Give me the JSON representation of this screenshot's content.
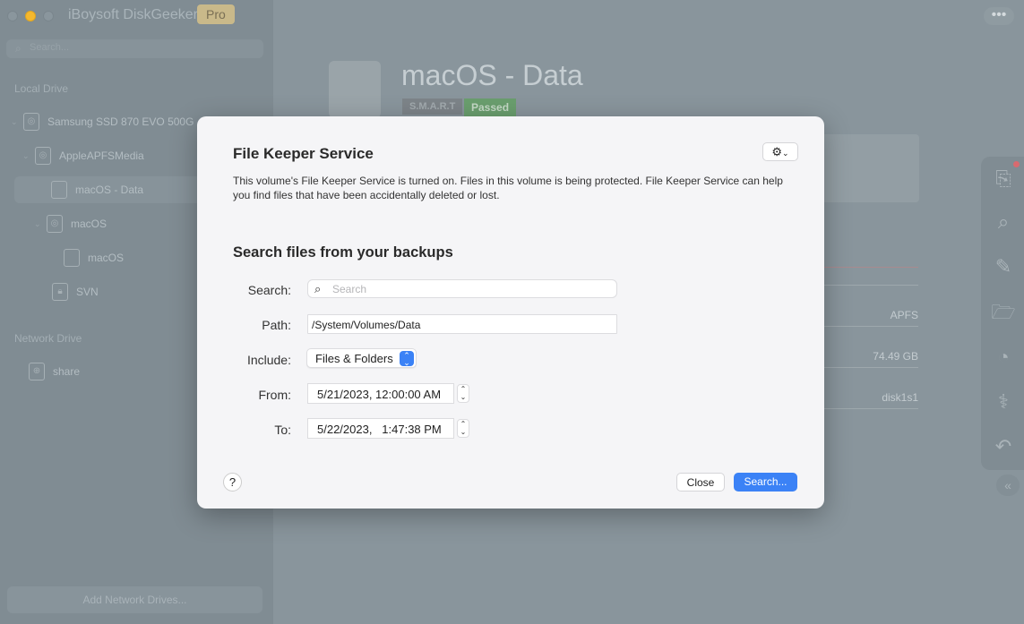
{
  "app": {
    "title": "iBoysoft DiskGeeker",
    "badge": "Pro",
    "search_placeholder": "Search..."
  },
  "sidebar": {
    "local_heading": "Local Drive",
    "items": [
      {
        "label": "Samsung SSD 870 EVO 500G",
        "icon": "disk-icon"
      },
      {
        "label": "AppleAPFSMedia",
        "icon": "disk-icon"
      },
      {
        "label": "macOS - Data",
        "icon": "volume-icon",
        "selected": true
      },
      {
        "label": "macOS",
        "icon": "disk-icon"
      },
      {
        "label": "macOS",
        "icon": "volume-icon"
      },
      {
        "label": "SVN",
        "icon": "locked-volume-icon"
      }
    ],
    "network_heading": "Network Drive",
    "network_items": [
      {
        "label": "share",
        "icon": "globe-icon"
      }
    ],
    "add_network": "Add Network Drives..."
  },
  "volume": {
    "title": "macOS - Data",
    "smart_label": "S.M.A.R.T",
    "smart_status": "Passed",
    "smart_color": "#6a9e6e",
    "format": "APFS",
    "capacity": "74.49 GB",
    "device": "disk1s1"
  },
  "dialog": {
    "title": "File Keeper Service",
    "description": "This volume's File Keeper Service is turned on. Files in this volume is being protected. File Keeper Service can help you find files that have been accidentally deleted or lost.",
    "section_title": "Search files from your backups",
    "search_label": "Search:",
    "search_placeholder": "Search",
    "path_label": "Path:",
    "path_value": "/System/Volumes/Data",
    "include_label": "Include:",
    "include_value": "Files & Folders",
    "from_label": "From:",
    "from_value": "5/21/2023, 12:00:00 AM",
    "to_label": "To:",
    "to_value": "5/22/2023,   1:47:38 PM",
    "help": "?",
    "close": "Close",
    "search_button": "Search...",
    "accent": "#3b82f6"
  }
}
